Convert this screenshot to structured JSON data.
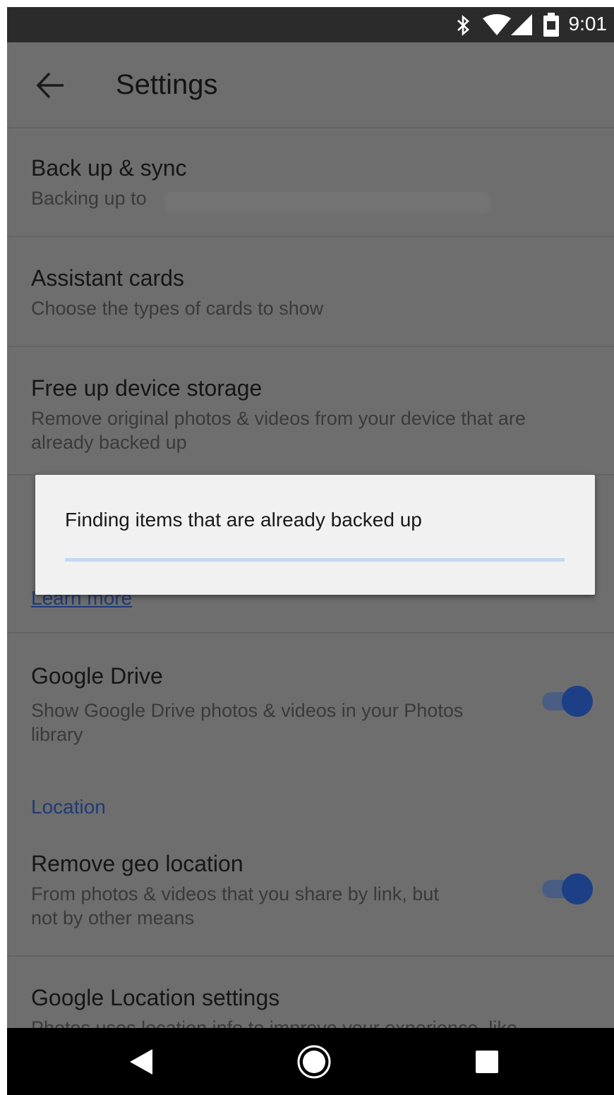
{
  "status_bar": {
    "time": "9:01",
    "icons": [
      "bluetooth-icon",
      "wifi-icon",
      "signal-icon",
      "battery-icon"
    ]
  },
  "app_bar": {
    "title": "Settings",
    "back_icon": "arrow-back-icon"
  },
  "settings": [
    {
      "title": "Back up & sync",
      "subtitle": "Backing up to"
    },
    {
      "title": "Assistant cards",
      "subtitle": "Choose the types of cards to show"
    },
    {
      "title": "Free up device storage",
      "subtitle_lines": [
        "Remove original photos & videos from your device that are",
        "already backed up"
      ]
    },
    {
      "title": "Google Drive",
      "subtitle_lines": [
        "Show Google Drive photos & videos in your Photos",
        "library"
      ],
      "toggle_on": true
    },
    {
      "title": "Remove geo location",
      "subtitle_lines": [
        "From photos & videos that you share by link, but",
        "not by other means"
      ],
      "toggle_on": true
    },
    {
      "title": "Google Location settings",
      "subtitle": "Photos uses location info to improve your experience, like"
    }
  ],
  "partial_link": "Learn more",
  "section": {
    "location_label": "Location"
  },
  "dialog": {
    "message": "Finding items that are already backed up",
    "progress_fraction": 0.0
  },
  "nav_bar": {
    "icons": [
      "back-triangle-icon",
      "home-circle-icon",
      "recents-square-icon"
    ]
  },
  "colors": {
    "accent": "#1d3f86",
    "scrim": "#6e6e6e",
    "status_bar": "#2b2b2b",
    "nav_bar": "#000000",
    "dialog_bg": "#f1f1f1",
    "progress_track": "#c5d7f3"
  }
}
